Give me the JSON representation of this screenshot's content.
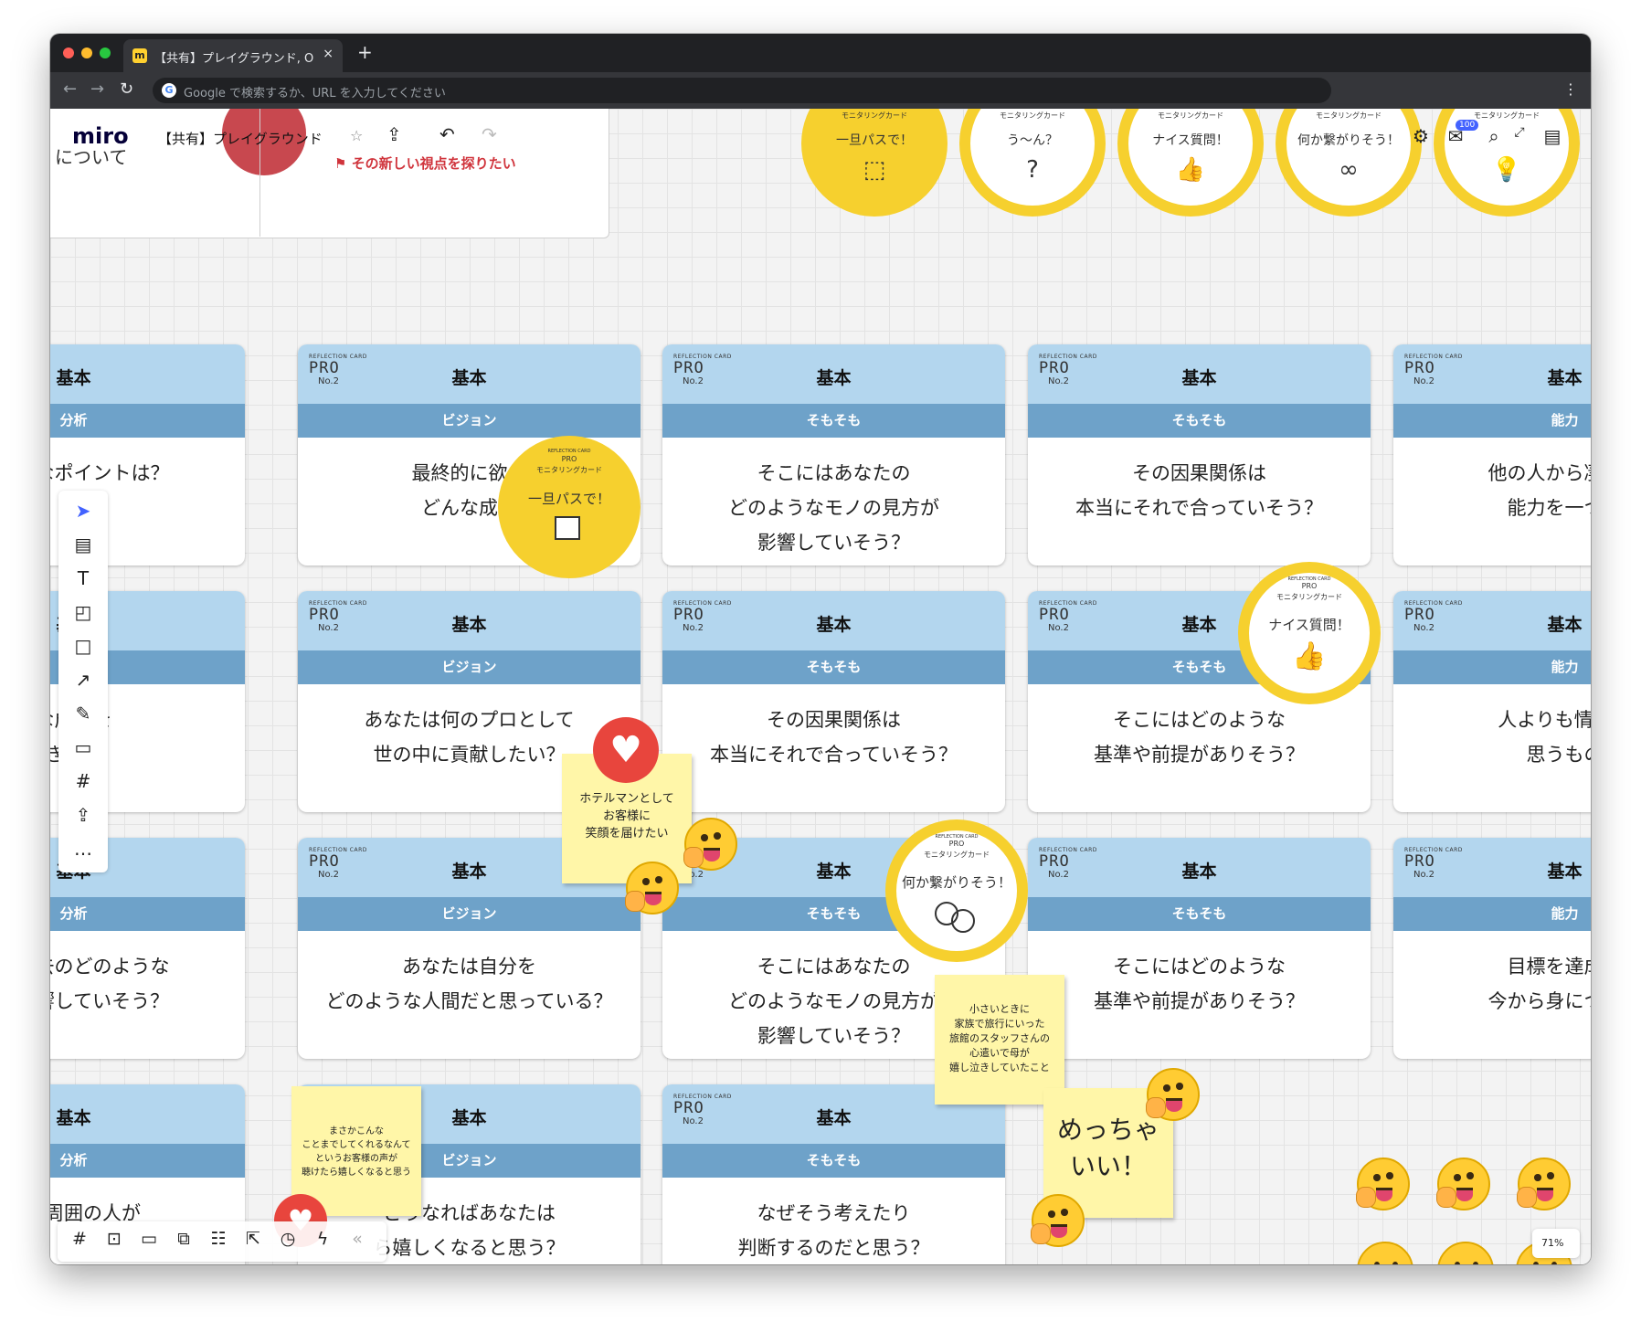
{
  "browser": {
    "tab_title": "【共有】プレイグラウンド, Online",
    "tab_close": "×",
    "new_tab": "+",
    "address_placeholder": "Google で検索するか、URL を入力してください",
    "google_letter": "G",
    "menu": "⋮"
  },
  "miro": {
    "logo": "miro",
    "board_name": "【共有】プレイグラウンド",
    "star": "☆",
    "notif_count": "100",
    "zoom": "71%"
  },
  "bg_frame": {
    "text_a": "について",
    "text_b": "その新しい視点を探りたい"
  },
  "monitoring_top": [
    {
      "label": "モニタリングカード",
      "text": "一旦パスで！",
      "icon": "box-icon"
    },
    {
      "label": "モニタリングカード",
      "text": "う〜ん？",
      "icon": "question-icon"
    },
    {
      "label": "モニタリングカード",
      "text": "ナイス質問！",
      "icon": "thumbs-up-icon"
    },
    {
      "label": "モニタリングカード",
      "text": "何か繋がりそう！",
      "icon": "circles-icon"
    },
    {
      "label": "モニタリングカード",
      "text": "",
      "icon": "lightbulb-icon"
    }
  ],
  "card_common": {
    "rc": "REFLECTION CARD",
    "pro": "PRO",
    "no": "No.2",
    "kihon": "基本"
  },
  "cards": [
    {
      "band": "分析",
      "q": "の大事なポイントは？"
    },
    {
      "band": "ビジョン",
      "q": "最終的に欲し\nどんな成果"
    },
    {
      "band": "そもそも",
      "q": "そこにはあなたの\nどのようなモノの見方が\n影響していそう？"
    },
    {
      "band": "そもそも",
      "q": "その因果関係は\n本当にそれで合っていそう？"
    },
    {
      "band": "能力",
      "q": "他の人から凄い！\n能力を一つあ"
    },
    {
      "band": "分析",
      "q": "な成功を\nきた？"
    },
    {
      "band": "ビジョン",
      "q": "あなたは何のプロとして\n世の中に貢献したい？"
    },
    {
      "band": "そもそも",
      "q": "その因果関係は\n本当にそれで合っていそう？"
    },
    {
      "band": "そもそも",
      "q": "そこにはどのような\n基準や前提がありそう？"
    },
    {
      "band": "能力",
      "q": "人よりも情熱を\n思うもの"
    },
    {
      "band": "分析",
      "q": "には過去のどのような\nドが影響していそう？"
    },
    {
      "band": "ビジョン",
      "q": "あなたは自分を\nどのような人間だと思っている？"
    },
    {
      "band": "そもそも",
      "q": "そこにはあなたの\nどのようなモノの見方が\n影響していそう？"
    },
    {
      "band": "そもそも",
      "q": "そこにはどのような\n基準や前提がありそう？"
    },
    {
      "band": "能力",
      "q": "目標を達成す\n今から身につけた"
    },
    {
      "band": "分析",
      "q": "には周囲の人が"
    },
    {
      "band": "ビジョン",
      "q": "どうなればあなたは\nら嬉しくなると思う？"
    },
    {
      "band": "そもそも",
      "q": "なぜそう考えたり\n判断するのだと思う？"
    }
  ],
  "monitoring_board": [
    {
      "rc": "REFLECTION CARD",
      "pro": "PRO",
      "label": "モニタリングカード",
      "text": "一旦パスで！"
    },
    {
      "rc": "REFLECTION CARD",
      "pro": "PRO",
      "label": "モニタリングカード",
      "text": "ナイス質問！"
    },
    {
      "rc": "REFLECTION CARD",
      "pro": "PRO",
      "label": "モニタリングカード",
      "text": "何か繋がりそう！"
    }
  ],
  "stickies": {
    "s1": "ホテルマンとして\nお客様に\n笑顔を届けたい",
    "s2": "小さいときに\n家族で旅行にいった\n旅館のスタッフさんの\n心遣いで母が\n嬉し泣きしていたこと",
    "s3": "まさかこんな\nことまでしてくれるなんて\nというお客様の声が\n聴けたら嬉しくなると思う",
    "s4": "めっちゃ\nいい！"
  },
  "left_tools": [
    "cursor-icon",
    "template-icon",
    "text-icon",
    "sticky-note-icon",
    "shape-icon",
    "arrow-icon",
    "pen-icon",
    "comment-icon",
    "frame-icon",
    "upload-icon",
    "more-icon"
  ],
  "left_tool_glyphs": [
    "➤",
    "▤",
    "T",
    "◰",
    "□",
    "↗",
    "✎",
    "▭",
    "#",
    "⇪",
    "…"
  ],
  "bottom_tools": [
    "frame-icon",
    "present-icon",
    "comment-icon",
    "cards-icon",
    "kanban-icon",
    "share-icon",
    "timer-icon",
    "lightning-icon",
    "collapse-icon"
  ],
  "bottom_tool_glyphs": [
    "#",
    "⊡",
    "▭",
    "⧉",
    "☷",
    "⇱",
    "◷",
    "ϟ",
    "«"
  ],
  "colors": {
    "card_head": "#b3d6ee",
    "card_band": "#6ea2c9",
    "monitor_yellow": "#f6d02e",
    "sticky": "#fff6a8",
    "heart": "#e8453d"
  }
}
